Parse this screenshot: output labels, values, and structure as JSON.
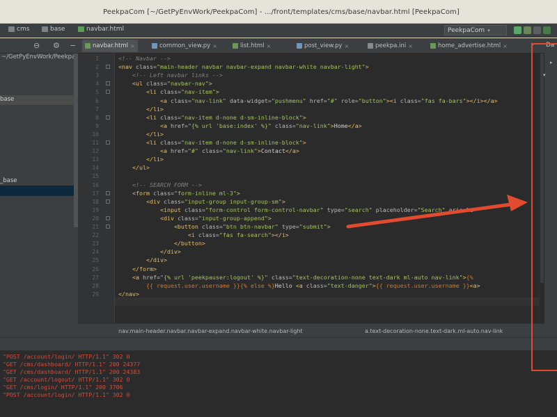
{
  "window": {
    "title": "PeekpaCom [~/GetPyEnvWork/PeekpaCom] - .../front/templates/cms/base/navbar.html [PeekpaCom]"
  },
  "navbar": {
    "crumbs": [
      {
        "label": "cms",
        "icon": "folder-icon"
      },
      {
        "label": "base",
        "icon": "folder-icon"
      },
      {
        "label": "navbar.html",
        "icon": "html-file-icon"
      }
    ],
    "run_config": "PeekpaCom"
  },
  "tabs": [
    {
      "label": "navbar.html",
      "active": true
    },
    {
      "label": "common_view.py",
      "active": false
    },
    {
      "label": "list.html",
      "active": false
    },
    {
      "label": "post_view.py",
      "active": false
    },
    {
      "label": "peekpa.ini",
      "active": false
    },
    {
      "label": "home_advertise.html",
      "active": false
    }
  ],
  "sidebar": {
    "path": "~/GetPyEnvWork/PeekpaCom",
    "selected": "base",
    "item": "_base"
  },
  "right_panel": {
    "label": "Da"
  },
  "editor": {
    "lines": [
      {
        "n": "1",
        "html": "<span class='t-cmt'>&lt;!-- Navbar --&gt;</span>"
      },
      {
        "n": "2",
        "html": "<span class='t-tag'>&lt;nav</span> <span class='t-attr'>class=</span><span class='t-str'>\"main-header navbar navbar-expand navbar-white navbar-light\"</span><span class='t-tag'>&gt;</span>"
      },
      {
        "n": "3",
        "html": "    <span class='t-cmt'>&lt;!-- Left navbar links --&gt;</span>"
      },
      {
        "n": "4",
        "html": "    <span class='t-tag'>&lt;ul</span> <span class='t-attr'>class=</span><span class='t-str'>\"navbar-nav\"</span><span class='t-tag'>&gt;</span>"
      },
      {
        "n": "5",
        "html": "        <span class='t-tag'>&lt;li</span> <span class='t-attr'>class=</span><span class='t-str'>\"nav-item\"</span><span class='t-tag'>&gt;</span>"
      },
      {
        "n": "6",
        "html": "            <span class='t-tag'>&lt;a</span> <span class='t-attr'>class=</span><span class='t-str'>\"nav-link\"</span> <span class='t-attr'>data-widget=</span><span class='t-str'>\"pushmenu\"</span> <span class='t-attr'>href=</span><span class='t-str'>\"#\"</span> <span class='t-attr'>role=</span><span class='t-str'>\"button\"</span><span class='t-tag'>&gt;&lt;i</span> <span class='t-attr'>class=</span><span class='t-str'>\"fas fa-bars\"</span><span class='t-tag'>&gt;&lt;/i&gt;&lt;/a&gt;</span>"
      },
      {
        "n": "7",
        "html": "        <span class='t-tag'>&lt;/li&gt;</span>"
      },
      {
        "n": "8",
        "html": "        <span class='t-tag'>&lt;li</span> <span class='t-attr'>class=</span><span class='t-str'>\"nav-item d-none d-sm-inline-block\"</span><span class='t-tag'>&gt;</span>"
      },
      {
        "n": "9",
        "html": "            <span class='t-tag'>&lt;a</span> <span class='t-attr'>href=</span><span class='t-str'>\"{% url 'base:index' %}\"</span> <span class='t-attr'>class=</span><span class='t-str'>\"nav-link\"</span><span class='t-tag'>&gt;</span><span class='t-txt'>Home</span><span class='t-tag'>&lt;/a&gt;</span>"
      },
      {
        "n": "10",
        "html": "        <span class='t-tag'>&lt;/li&gt;</span>"
      },
      {
        "n": "11",
        "html": "        <span class='t-tag'>&lt;li</span> <span class='t-attr'>class=</span><span class='t-str'>\"nav-item d-none d-sm-inline-block\"</span><span class='t-tag'>&gt;</span>"
      },
      {
        "n": "12",
        "html": "            <span class='t-tag'>&lt;a</span> <span class='t-attr'>href=</span><span class='t-str'>\"#\"</span> <span class='t-attr'>class=</span><span class='t-str'>\"nav-link\"</span><span class='t-tag'>&gt;</span><span class='t-txt'>Contact</span><span class='t-tag'>&lt;/a&gt;</span>"
      },
      {
        "n": "13",
        "html": "        <span class='t-tag'>&lt;/li&gt;</span>"
      },
      {
        "n": "14",
        "html": "    <span class='t-tag'>&lt;/ul&gt;</span>"
      },
      {
        "n": "15",
        "html": ""
      },
      {
        "n": "16",
        "html": "    <span class='t-cmt'>&lt;!-- SEARCH FORM --&gt;</span>"
      },
      {
        "n": "17",
        "html": "    <span class='t-tag'>&lt;form</span> <span class='t-attr'>class=</span><span class='t-str'>\"form-inline ml-3\"</span><span class='t-tag'>&gt;</span>"
      },
      {
        "n": "18",
        "html": "        <span class='t-tag'>&lt;div</span> <span class='t-attr'>class=</span><span class='t-str'>\"input-group input-group-sm\"</span><span class='t-tag'>&gt;</span>"
      },
      {
        "n": "19",
        "html": "            <span class='t-tag'>&lt;input</span> <span class='t-attr'>class=</span><span class='t-str'>\"form-control form-control-navbar\"</span> <span class='t-attr'>type=</span><span class='t-str'>\"search\"</span> <span class='t-attr'>placeholder=</span><span class='t-str'>\"Search\"</span> <span class='t-attr'>aria-la</span>"
      },
      {
        "n": "20",
        "html": "            <span class='t-tag'>&lt;div</span> <span class='t-attr'>class=</span><span class='t-str'>\"input-group-append\"</span><span class='t-tag'>&gt;</span>"
      },
      {
        "n": "21",
        "html": "                <span class='t-tag'>&lt;button</span> <span class='t-attr'>class=</span><span class='t-str'>\"btn btn-navbar\"</span> <span class='t-attr'>type=</span><span class='t-str'>\"submit\"</span><span class='t-tag'>&gt;</span>"
      },
      {
        "n": "22",
        "html": "                    <span class='t-tag'>&lt;i</span> <span class='t-attr'>class=</span><span class='t-str'>\"fas fa-search\"</span><span class='t-tag'>&gt;&lt;/i&gt;</span>"
      },
      {
        "n": "23",
        "html": "                <span class='t-tag'>&lt;/button&gt;</span>"
      },
      {
        "n": "24",
        "html": "            <span class='t-tag'>&lt;/div&gt;</span>"
      },
      {
        "n": "25",
        "html": "        <span class='t-tag'>&lt;/div&gt;</span>"
      },
      {
        "n": "26",
        "html": "    <span class='t-tag'>&lt;/form&gt;</span>"
      },
      {
        "n": "27",
        "html": "    <span class='t-tag'>&lt;a</span> <span class='t-attr'>href=</span><span class='t-str'>\"{% url 'peekpauser:logout' %}\"</span> <span class='t-attr'>class=</span><span class='t-str'>\"text-decoration-none text-dark ml-auto nav-link\"</span><span class='t-tag'>&gt;</span><span class='t-kw'>{%</span>"
      },
      {
        "n": "28",
        "html": "        <span class='t-kw'>{{ request.user.username }}{% else %}</span><span class='t-txt'>Hello</span> <span class='t-tag'>&lt;a</span> <span class='t-attr'>class=</span><span class='t-str'>\"text-danger\"</span><span class='t-tag'>&gt;</span><span class='t-kw'>{{ request.user.username }}</span><span class='t-tag'>&lt;a&gt;</span>"
      },
      {
        "n": "29",
        "html": "<span class='t-tag'>&lt;/nav&gt;</span>"
      }
    ]
  },
  "breadcrumbs": [
    "nav.main-header.navbar.navbar-expand.navbar-white.navbar-light",
    "a.text-decoration-none.text-dark.ml-auto.nav-link"
  ],
  "console": {
    "lines": [
      "\"POST /account/login/ HTTP/1.1\" 302 0",
      "\"GET /cms/dashboard/ HTTP/1.1\" 200 24377",
      "\"GET /cms/dashboard/ HTTP/1.1\" 200 24383",
      "\"GET /account/logout/ HTTP/1.1\" 302 0",
      "\"GET /cms/login/ HTTP/1.1\" 200 3706",
      "\"POST /account/login/ HTTP/1.1\" 302 0"
    ]
  },
  "colors": {
    "annotation": "#e14b2f",
    "editor_bg": "#2b2b2b",
    "log_text": "#d84b3a"
  }
}
